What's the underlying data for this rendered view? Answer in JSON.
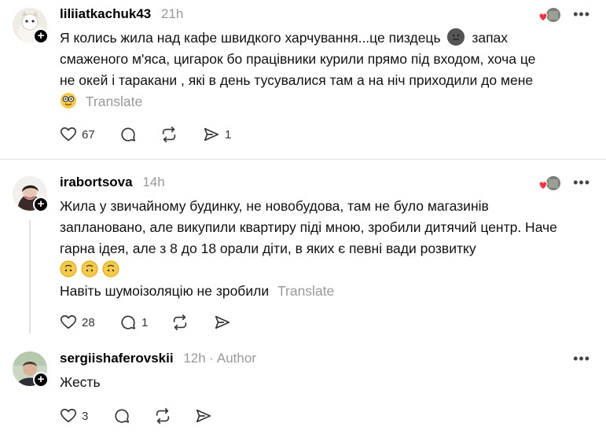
{
  "posts": [
    {
      "username": "liliiatkachuk43",
      "time": "21h",
      "text_lines": [
        "Я колись жила над кафе швидкого харчування...це пиздець",
        "запах",
        "смаженого м'яса, цигарок бо працівники курили прямо під входом, хоча це",
        "не окей і таракани , які в день тусувалися там а на ніч приходили до мене"
      ],
      "translate": "Translate",
      "likes": "67",
      "replies": "",
      "shares": "1"
    },
    {
      "username": "irabortsova",
      "time": "14h",
      "text_lines": [
        "Жила у звичайному будинку, не новобудова, там не було магазинів",
        "заплановано, але викупили квартиру піді мною, зробили дитячий центр. Наче",
        "гарна ідея, але з 8 до 18 орали діти, в яких є певні вади розвитку",
        "Навіть шумоізоляцію не зробили"
      ],
      "translate": "Translate",
      "likes": "28",
      "replies": "1",
      "shares": ""
    },
    {
      "username": "sergiishaferovskii",
      "time": "12h",
      "author_badge": "· Author",
      "text_lines": [
        "Жесть"
      ],
      "likes": "3",
      "replies": "",
      "shares": ""
    }
  ],
  "more_label": "•••",
  "icons": {
    "heart": "heart-icon",
    "reply": "comment-icon",
    "repost": "repost-icon",
    "share": "share-icon",
    "follow": "plus-icon"
  },
  "colors": {
    "like_red": "#ff3040",
    "muted": "#999999"
  }
}
